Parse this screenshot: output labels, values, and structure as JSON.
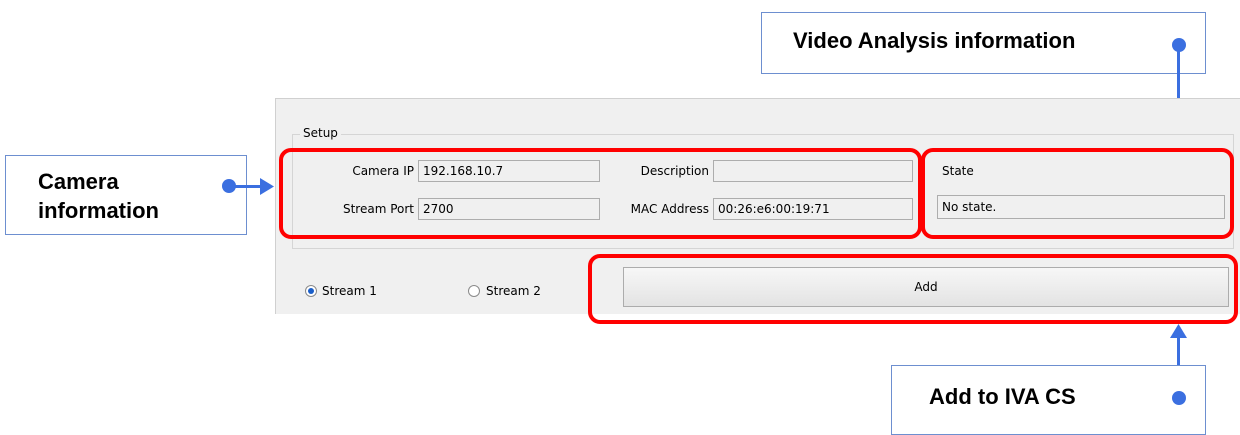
{
  "callouts": {
    "video_analysis": "Video Analysis information",
    "camera_line1": "Camera",
    "camera_line2": "information",
    "add_to_iva": "Add to IVA CS"
  },
  "setup": {
    "group_title": "Setup",
    "camera_ip_label": "Camera IP",
    "camera_ip_value": "192.168.10.7",
    "stream_port_label": "Stream Port",
    "stream_port_value": "2700",
    "description_label": "Description",
    "description_value": "",
    "mac_label": "MAC Address",
    "mac_value": "00:26:e6:00:19:71",
    "state_label": "State",
    "state_value": "No state."
  },
  "streams": {
    "stream1_label": "Stream 1",
    "stream2_label": "Stream 2",
    "selected": "Stream 1"
  },
  "add_button_label": "Add",
  "colors": {
    "highlight": "#ff0000",
    "annotation": "#3b6fe0"
  }
}
